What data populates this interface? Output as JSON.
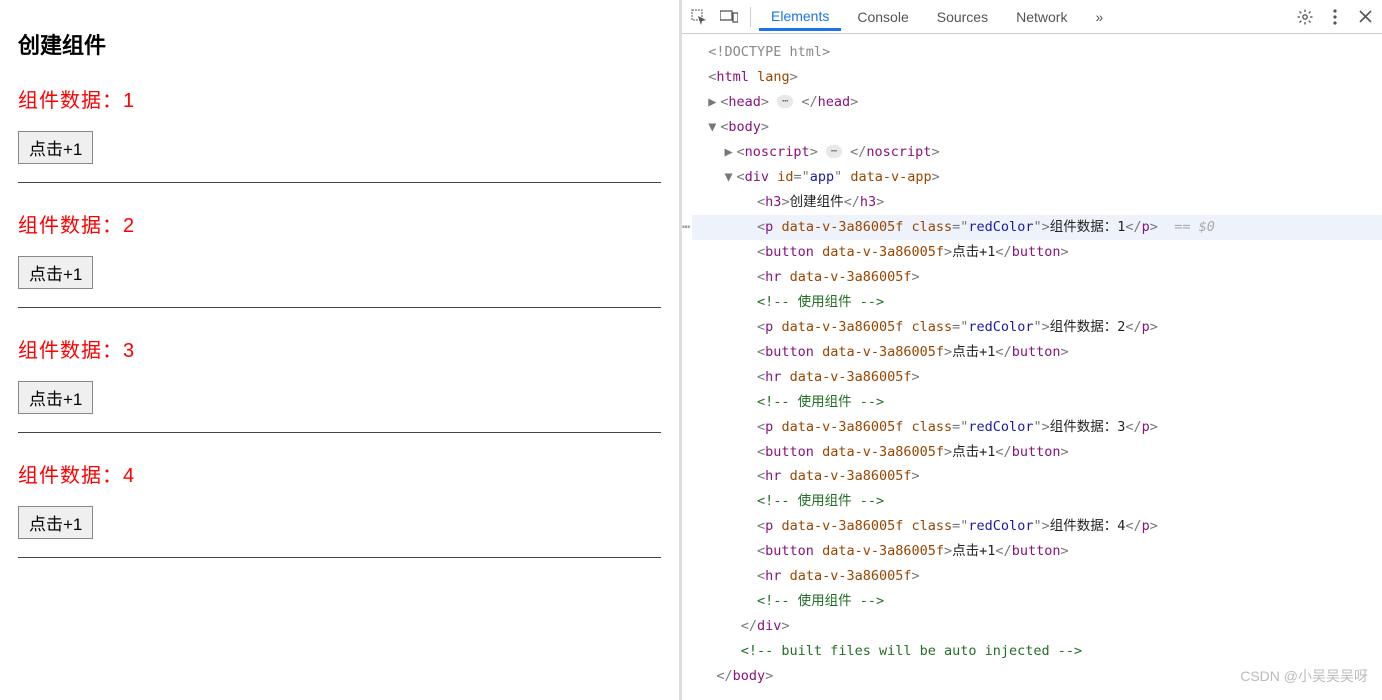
{
  "app": {
    "title": "创建组件",
    "components": [
      {
        "label": "组件数据：1",
        "button": "点击+1"
      },
      {
        "label": "组件数据：2",
        "button": "点击+1"
      },
      {
        "label": "组件数据：3",
        "button": "点击+1"
      },
      {
        "label": "组件数据：4",
        "button": "点击+1"
      }
    ]
  },
  "devtools": {
    "tabs": {
      "elements": "Elements",
      "console": "Console",
      "sources": "Sources",
      "network": "Network",
      "more": "»"
    },
    "dom": {
      "doctype": "<!DOCTYPE html>",
      "html_open": "<html lang>",
      "head": {
        "open": "<head>",
        "close": "</head>"
      },
      "body_open": "<body>",
      "noscript": {
        "open": "<noscript>",
        "close": "</noscript>"
      },
      "app_div": {
        "tag": "div",
        "id": "app",
        "attr2": "data-v-app"
      },
      "h3": {
        "open": "<h3>",
        "text": "创建组件",
        "close": "</h3>"
      },
      "p_attr_scope": "data-v-3a86005f",
      "p_class": "redColor",
      "selected_marker": "== $0",
      "items": [
        {
          "text": "组件数据：1",
          "button_text": "点击+1",
          "comment": "<!-- 使用组件 -->",
          "selected": true
        },
        {
          "text": "组件数据：2",
          "button_text": "点击+1",
          "comment": "<!-- 使用组件 -->"
        },
        {
          "text": "组件数据：3",
          "button_text": "点击+1",
          "comment": "<!-- 使用组件 -->"
        },
        {
          "text": "组件数据：4",
          "button_text": "点击+1",
          "comment": "<!-- 使用组件 -->"
        }
      ],
      "div_close": "</div>",
      "inject_comment": "<!-- built files will be auto injected -->",
      "body_close": "</body>"
    }
  },
  "watermark": "CSDN @小吴吴吴呀"
}
